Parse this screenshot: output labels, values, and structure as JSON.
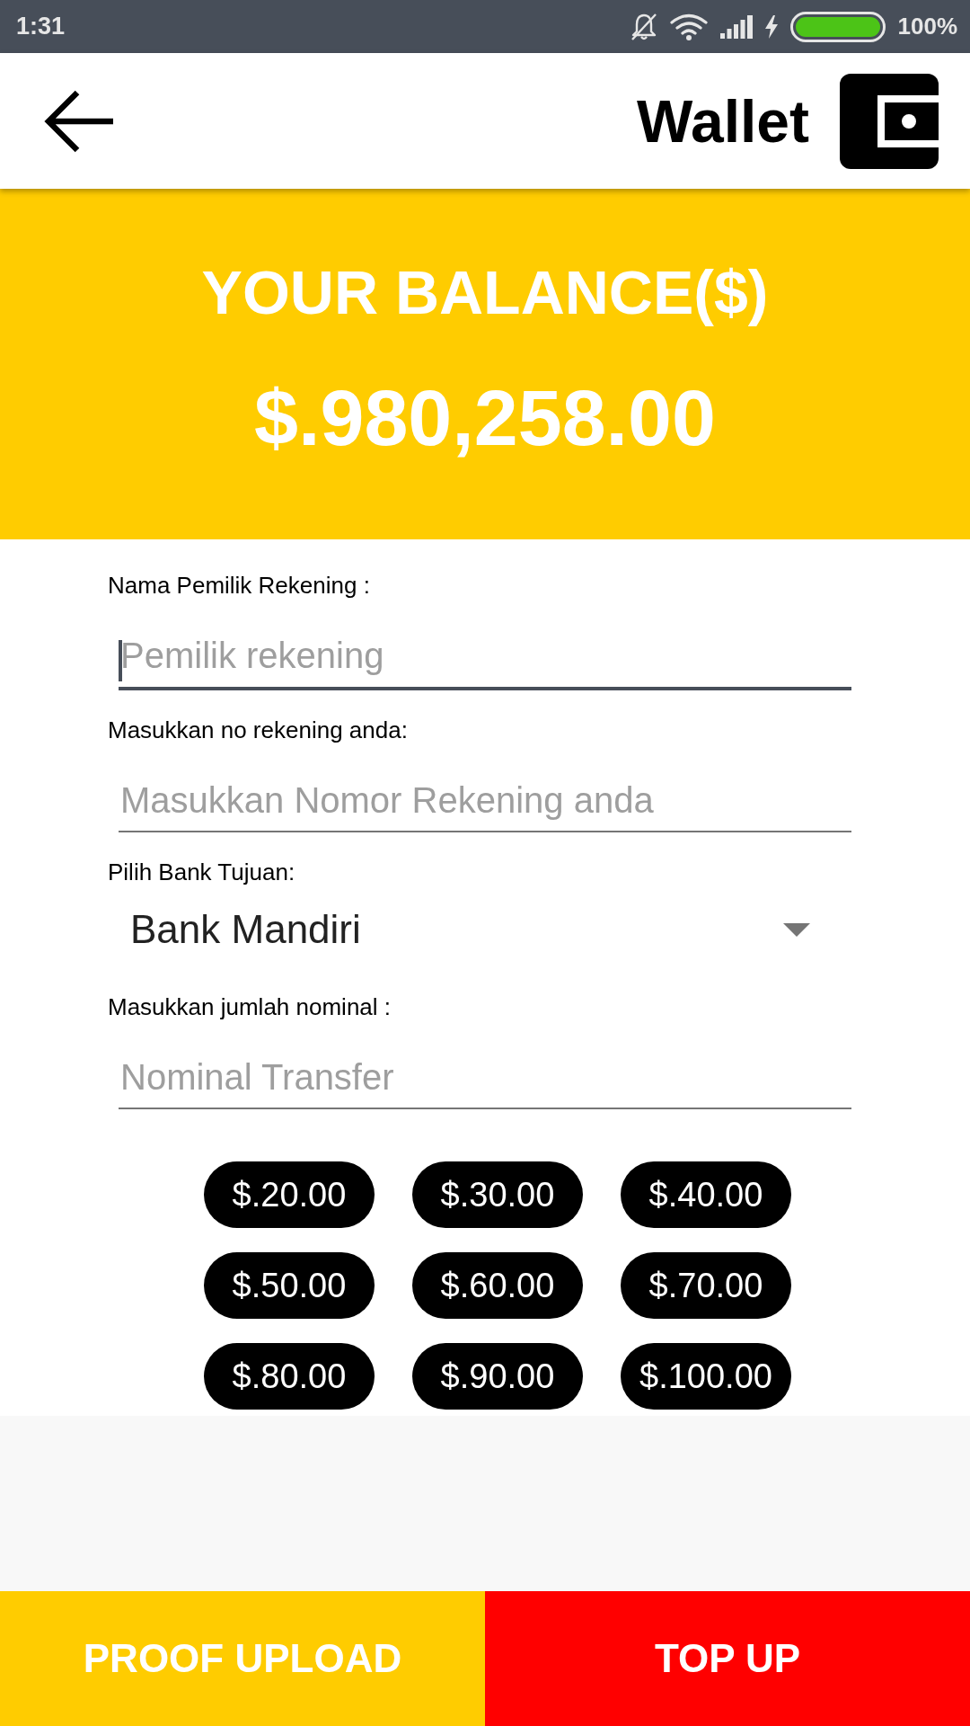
{
  "status_bar": {
    "time": "1:31",
    "battery": "100%"
  },
  "app_bar": {
    "title": "Wallet"
  },
  "balance": {
    "label": "YOUR BALANCE($)",
    "amount": "$.980,258.00"
  },
  "form": {
    "fields": [
      {
        "kind": "text",
        "label": "Nama Pemilik Rekening :",
        "placeholder": "Pemilik rekening",
        "focused": true
      },
      {
        "kind": "text",
        "label": "Masukkan no rekening anda:",
        "placeholder": "Masukkan Nomor Rekening anda",
        "focused": false
      },
      {
        "kind": "dropdown",
        "label": "Pilih Bank Tujuan:",
        "value": "Bank Mandiri"
      },
      {
        "kind": "text",
        "label": "Masukkan jumlah nominal :",
        "placeholder": "Nominal Transfer",
        "focused": false
      }
    ]
  },
  "amount_chips": [
    "$.20.00",
    "$.30.00",
    "$.40.00",
    "$.50.00",
    "$.60.00",
    "$.70.00",
    "$.80.00",
    "$.90.00",
    "$.100.00"
  ],
  "buttons": [
    {
      "label": "PROOF UPLOAD",
      "kind": "secondary"
    },
    {
      "label": "TOP UP",
      "kind": "primary"
    }
  ]
}
